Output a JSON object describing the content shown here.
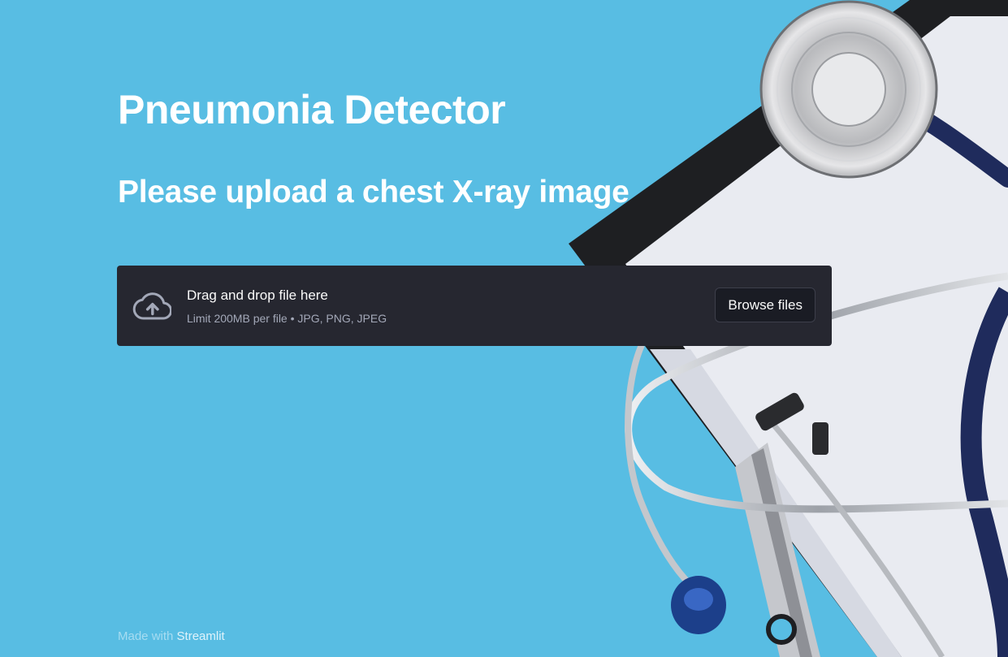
{
  "app": {
    "title": "Pneumonia Detector",
    "subtitle": "Please upload a chest X-ray image"
  },
  "uploader": {
    "icon": "cloud-upload-icon",
    "drag_text": "Drag and drop file here",
    "limit_text": "Limit 200MB per file • JPG, PNG, JPEG",
    "browse_label": "Browse files"
  },
  "footer": {
    "prefix": "Made with ",
    "link": "Streamlit"
  },
  "colors": {
    "background": "#58bde3",
    "uploader_bg": "#262730",
    "text_primary": "#fafafa",
    "text_secondary": "#a3a8b8"
  }
}
